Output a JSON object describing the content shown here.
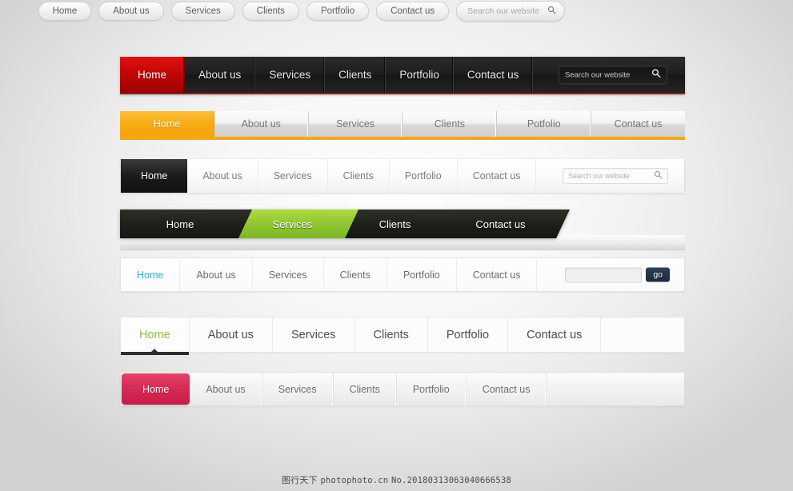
{
  "background": {
    "vignette_center": "#fdfdfd",
    "vignette_edge": "#d2d2d2"
  },
  "bars": {
    "bar1": {
      "style_name": "dark-red-navbar",
      "accent": "#c20606",
      "items": [
        {
          "label": "Home",
          "active": true
        },
        {
          "label": "About us",
          "active": false
        },
        {
          "label": "Services",
          "active": false
        },
        {
          "label": "Clients",
          "active": false
        },
        {
          "label": "Portfolio",
          "active": false
        },
        {
          "label": "Contact us",
          "active": false
        }
      ],
      "search": {
        "placeholder": "Search our website",
        "value": "",
        "icon": "search-icon"
      }
    },
    "bar2": {
      "style_name": "orange-silver-navbar",
      "accent": "#f5a50b",
      "items": [
        {
          "label": "Home",
          "active": true
        },
        {
          "label": "About us",
          "active": false
        },
        {
          "label": "Services",
          "active": false
        },
        {
          "label": "Clients",
          "active": false
        },
        {
          "label": "Potfolio",
          "active": false
        },
        {
          "label": "Contact us",
          "active": false
        }
      ]
    },
    "bar3": {
      "style_name": "black-home-light-navbar",
      "accent": "#1b1b1b",
      "items": [
        {
          "label": "Home",
          "active": true
        },
        {
          "label": "About us",
          "active": false
        },
        {
          "label": "Services",
          "active": false
        },
        {
          "label": "Clients",
          "active": false
        },
        {
          "label": "Portfolio",
          "active": false
        },
        {
          "label": "Contact us",
          "active": false
        }
      ],
      "search": {
        "placeholder": "Search our website",
        "value": "",
        "icon": "search-icon"
      }
    },
    "bar4": {
      "style_name": "green-slanted-navbar",
      "accent": "#8fc530",
      "items": [
        {
          "label": "Home",
          "active": false
        },
        {
          "label": "Services",
          "active": true
        },
        {
          "label": "Clients",
          "active": false
        },
        {
          "label": "Contact us",
          "active": false
        }
      ]
    },
    "bar5": {
      "style_name": "teal-home-go-navbar",
      "accent": "#36aec3",
      "items": [
        {
          "label": "Home",
          "active": true
        },
        {
          "label": "About us",
          "active": false
        },
        {
          "label": "Services",
          "active": false
        },
        {
          "label": "Clients",
          "active": false
        },
        {
          "label": "Portfolio",
          "active": false
        },
        {
          "label": "Contact us",
          "active": false
        }
      ],
      "search": {
        "placeholder": "",
        "value": "",
        "button_label": "go",
        "button_color": "#1d2c3d"
      }
    },
    "bar6": {
      "style_name": "green-underline-navbar",
      "accent": "#8cbf3f",
      "marker_color": "#2d2d2d",
      "items": [
        {
          "label": "Home",
          "active": true
        },
        {
          "label": "About us",
          "active": false
        },
        {
          "label": "Services",
          "active": false
        },
        {
          "label": "Clients",
          "active": false
        },
        {
          "label": "Portfolio",
          "active": false
        },
        {
          "label": "Contact us",
          "active": false
        }
      ]
    },
    "bar7": {
      "style_name": "pink-home-navbar",
      "accent": "#d52a54",
      "items": [
        {
          "label": "Home",
          "active": true
        },
        {
          "label": "About us",
          "active": false
        },
        {
          "label": "Services",
          "active": false
        },
        {
          "label": "Clients",
          "active": false
        },
        {
          "label": "Portfolio",
          "active": false
        },
        {
          "label": "Contact us",
          "active": false
        }
      ]
    },
    "bar8": {
      "style_name": "pill-button-navbar",
      "items": [
        {
          "label": "Home"
        },
        {
          "label": "About us"
        },
        {
          "label": "Services"
        },
        {
          "label": "Clients"
        },
        {
          "label": "Portfolio"
        },
        {
          "label": "Contact us"
        }
      ],
      "search": {
        "placeholder": "Search our website",
        "value": "",
        "icon": "search-icon"
      }
    }
  },
  "watermark": {
    "brand": "图行天下",
    "site": "photophoto.cn",
    "code": "No.20180313063040666538"
  }
}
